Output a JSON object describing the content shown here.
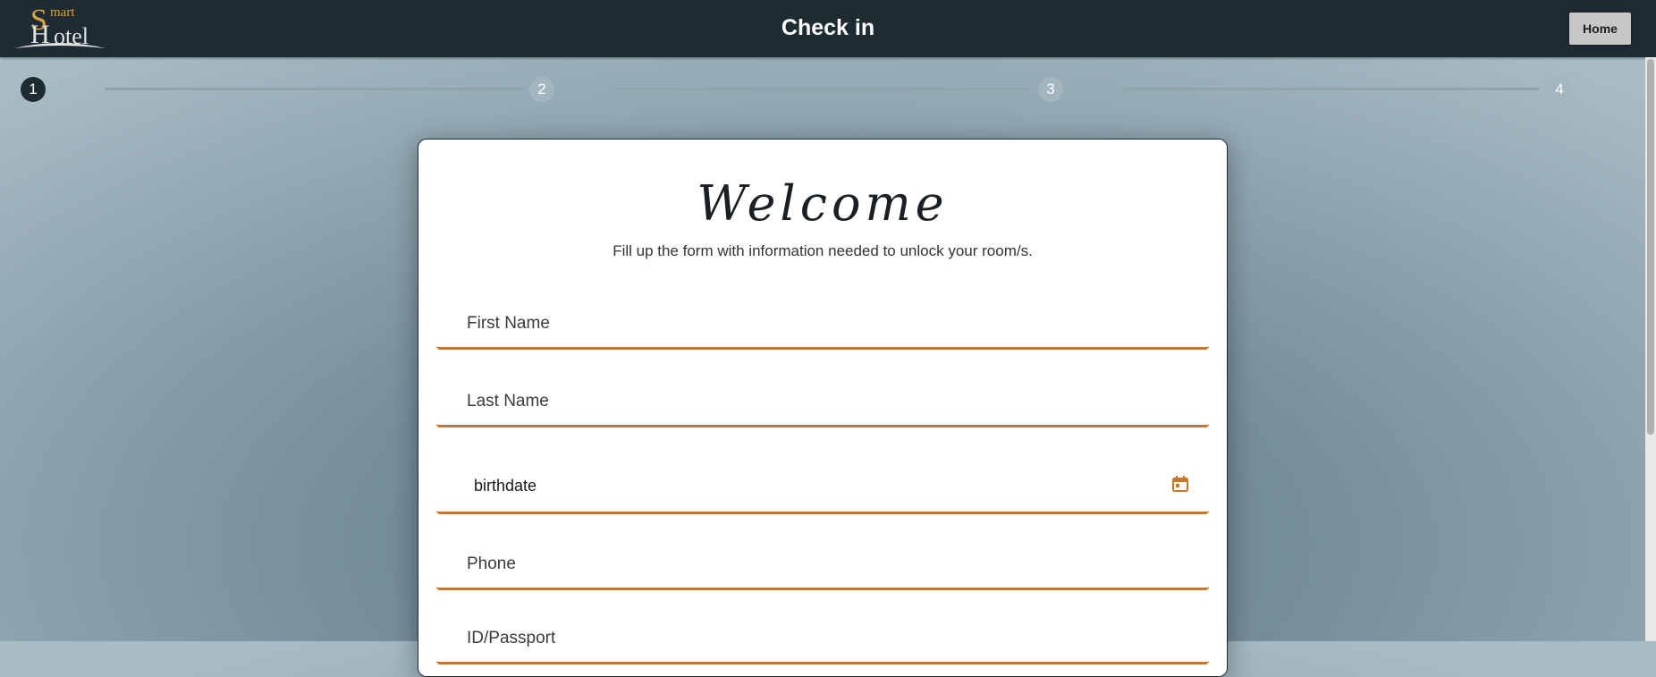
{
  "header": {
    "logo": {
      "s": "S",
      "mart": "mart",
      "h": "H",
      "otel": "otel"
    },
    "title": "Check in",
    "home_label": "Home"
  },
  "stepper": {
    "steps": [
      "1",
      "2",
      "3",
      "4"
    ],
    "active_step": 1
  },
  "form": {
    "heading": "Welcome",
    "subtitle": "Fill up the form with information needed to unlock your room/s.",
    "fields": {
      "first_name": {
        "placeholder": "First Name"
      },
      "last_name": {
        "placeholder": "Last Name"
      },
      "birthdate": {
        "value": "birthdate",
        "icon": "calendar-icon"
      },
      "phone": {
        "placeholder": "Phone"
      },
      "id_passport": {
        "placeholder": "ID/Passport"
      }
    }
  },
  "colors": {
    "topbar": "#1e2b32",
    "accent": "#cd7526",
    "logo_gold": "#d8a23c",
    "step_active": "#1e2b32",
    "step_inactive": "#a3b6bf"
  }
}
